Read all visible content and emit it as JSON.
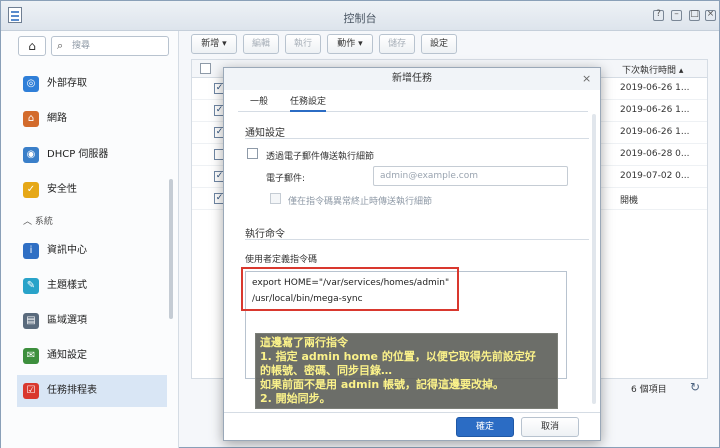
{
  "window": {
    "title": "控制台"
  },
  "sidebar": {
    "search_placeholder": "搜尋",
    "items": [
      {
        "label": "外部存取",
        "icon": "external-access-icon",
        "color": "#2f7fd8"
      },
      {
        "label": "網路",
        "icon": "network-icon",
        "color": "#d36b2c"
      },
      {
        "label": "DHCP 伺服器",
        "icon": "dhcp-server-icon",
        "color": "#3a7fc9"
      },
      {
        "label": "安全性",
        "icon": "shield-icon",
        "color": "#e6a817"
      },
      {
        "label": "資訊中心",
        "icon": "info-icon",
        "color": "#2f6fc4"
      },
      {
        "label": "主題樣式",
        "icon": "theme-icon",
        "color": "#29a3c9"
      },
      {
        "label": "區域選項",
        "icon": "region-icon",
        "color": "#5a6b7d"
      },
      {
        "label": "通知設定",
        "icon": "notification-icon",
        "color": "#3d8f3d"
      },
      {
        "label": "任務排程表",
        "icon": "calendar-icon",
        "color": "#d9382e"
      }
    ],
    "section_system": "系統"
  },
  "toolbar": {
    "create": "新增",
    "edit": "編輯",
    "run": "執行",
    "action": "動作",
    "save": "儲存",
    "settings": "設定"
  },
  "grid": {
    "header_next_run": "下次執行時間",
    "rows": [
      {
        "checked": true,
        "next_run": "2019-06-26 1..."
      },
      {
        "checked": true,
        "next_run": "2019-06-26 1..."
      },
      {
        "checked": true,
        "next_run": "2019-06-26 1..."
      },
      {
        "checked": false,
        "next_run": "2019-06-28 0..."
      },
      {
        "checked": true,
        "next_run": "2019-07-02 0..."
      },
      {
        "checked": true,
        "next_run": "開機"
      }
    ],
    "footer_count": "6 個項目"
  },
  "modal": {
    "title": "新增任務",
    "tabs": [
      "一般",
      "任務設定"
    ],
    "notify_section": "通知設定",
    "send_email_label": "透過電子郵件傳送執行細節",
    "email_label": "電子郵件:",
    "email_placeholder": "admin@example.com",
    "abnormal_only_label": "僅在指令碼異常終止時傳送執行細節",
    "run_section": "執行命令",
    "user_script_label": "使用者定義指令碼",
    "script_lines": [
      "export HOME=\"/var/services/homes/admin\"",
      "/usr/local/bin/mega-sync"
    ],
    "ok": "確定",
    "cancel": "取消"
  },
  "annotation": {
    "lines": [
      "這邊寫了兩行指令",
      "1. 指定 admin home 的位置，以便它取得先前設定好",
      "    的帳號、密碼、同步目錄…",
      "    如果前面不是用 admin 帳號，記得這邊要改掉。",
      "2. 開始同步。"
    ]
  }
}
